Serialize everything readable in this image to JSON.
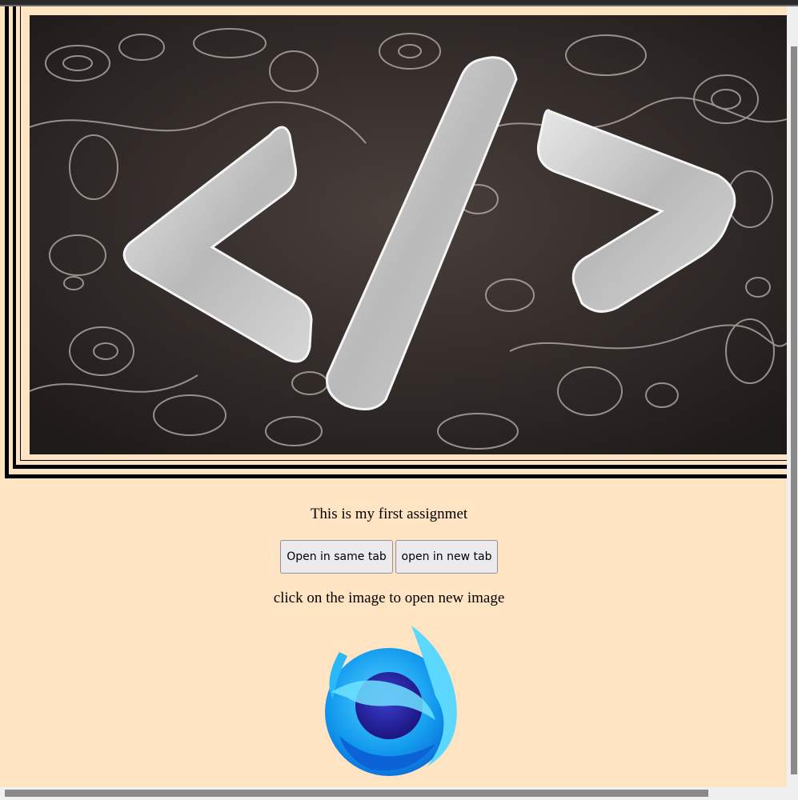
{
  "page": {
    "caption": "This is my first assignmet",
    "hint": "click on the image to open new image",
    "background_color": "#ffe4c4"
  },
  "buttons": {
    "same_tab_label": "Open in same tab",
    "new_tab_label": "open in new tab"
  },
  "images": {
    "hero_icon": "code-brackets-icon",
    "logo_icon": "firefox-developer-logo-icon"
  }
}
